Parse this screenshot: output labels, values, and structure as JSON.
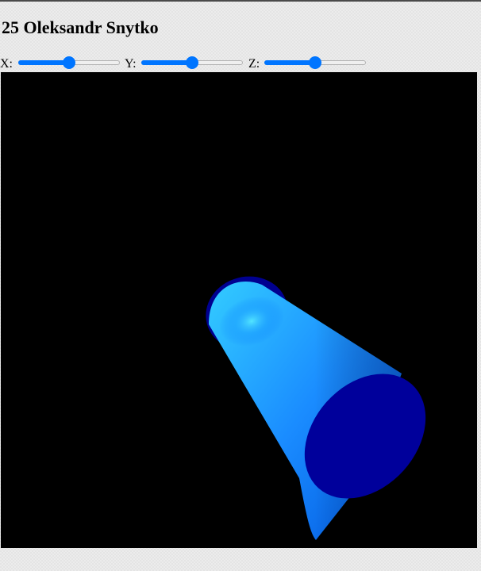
{
  "page": {
    "title": "25 Oleksandr Snytko"
  },
  "controls": [
    {
      "label": "X:",
      "value": 0.5
    },
    {
      "label": "Y:",
      "value": 0.5
    },
    {
      "label": "Z:",
      "value": 0.5
    }
  ],
  "scene": {
    "background": "#000000",
    "object": "cone-frustum",
    "colors": {
      "body_light": "#33ccff",
      "body_mid": "#1a8cff",
      "body_dark": "#0055dd",
      "end_cap": "#00009b",
      "top_cap": "#000090"
    }
  }
}
